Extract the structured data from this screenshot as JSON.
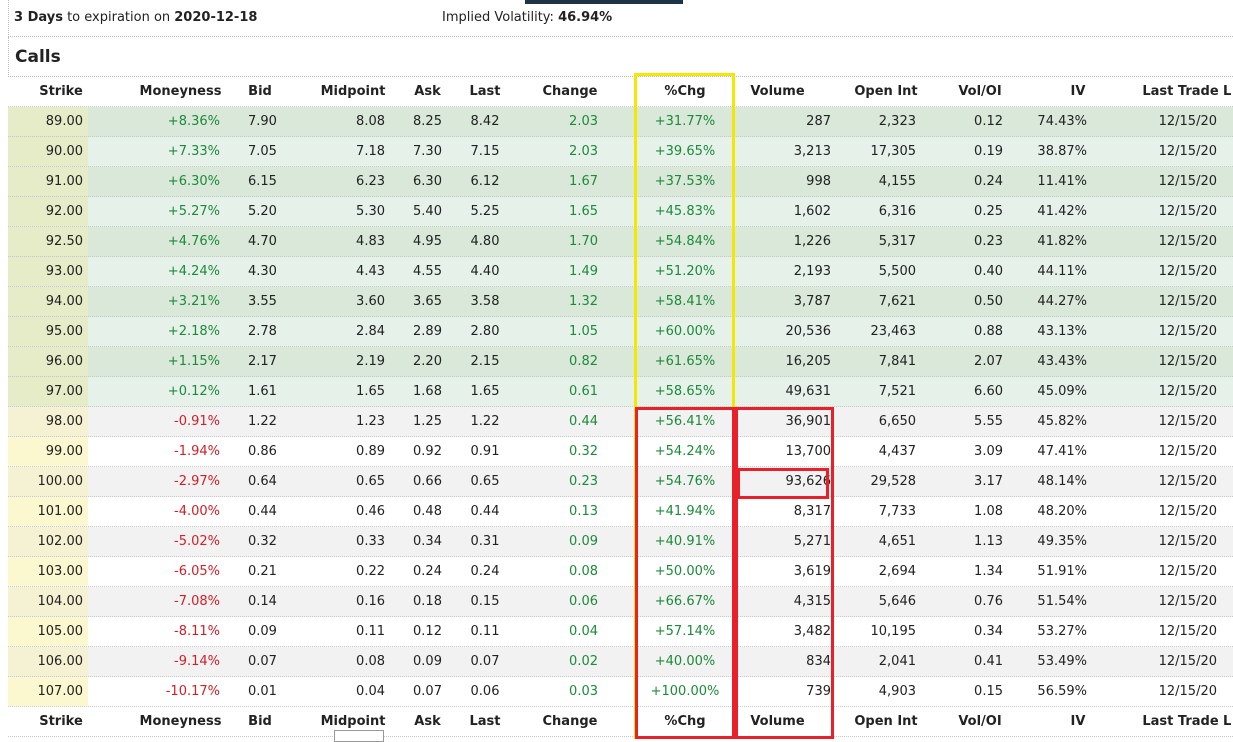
{
  "header": {
    "days": "3 Days",
    "to_expiration": " to expiration on ",
    "date": "2020-12-18",
    "iv_label": "Implied Volatility: ",
    "iv_value": "46.94%"
  },
  "section_title": "Calls",
  "columns": [
    "Strike",
    "Moneyness",
    "Bid",
    "Midpoint",
    "Ask",
    "Last",
    "Change",
    "%Chg",
    "Volume",
    "Open Int",
    "Vol/OI",
    "IV",
    "Last Trade",
    "L"
  ],
  "rows": [
    [
      "89.00",
      "+8.36%",
      "7.90",
      "8.08",
      "8.25",
      "8.42",
      "2.03",
      "+31.77%",
      "287",
      "2,323",
      "0.12",
      "74.43%",
      "12/15/20"
    ],
    [
      "90.00",
      "+7.33%",
      "7.05",
      "7.18",
      "7.30",
      "7.15",
      "2.03",
      "+39.65%",
      "3,213",
      "17,305",
      "0.19",
      "38.87%",
      "12/15/20"
    ],
    [
      "91.00",
      "+6.30%",
      "6.15",
      "6.23",
      "6.30",
      "6.12",
      "1.67",
      "+37.53%",
      "998",
      "4,155",
      "0.24",
      "11.41%",
      "12/15/20"
    ],
    [
      "92.00",
      "+5.27%",
      "5.20",
      "5.30",
      "5.40",
      "5.25",
      "1.65",
      "+45.83%",
      "1,602",
      "6,316",
      "0.25",
      "41.42%",
      "12/15/20"
    ],
    [
      "92.50",
      "+4.76%",
      "4.70",
      "4.83",
      "4.95",
      "4.80",
      "1.70",
      "+54.84%",
      "1,226",
      "5,317",
      "0.23",
      "41.82%",
      "12/15/20"
    ],
    [
      "93.00",
      "+4.24%",
      "4.30",
      "4.43",
      "4.55",
      "4.40",
      "1.49",
      "+51.20%",
      "2,193",
      "5,500",
      "0.40",
      "44.11%",
      "12/15/20"
    ],
    [
      "94.00",
      "+3.21%",
      "3.55",
      "3.60",
      "3.65",
      "3.58",
      "1.32",
      "+58.41%",
      "3,787",
      "7,621",
      "0.50",
      "44.27%",
      "12/15/20"
    ],
    [
      "95.00",
      "+2.18%",
      "2.78",
      "2.84",
      "2.89",
      "2.80",
      "1.05",
      "+60.00%",
      "20,536",
      "23,463",
      "0.88",
      "43.13%",
      "12/15/20"
    ],
    [
      "96.00",
      "+1.15%",
      "2.17",
      "2.19",
      "2.20",
      "2.15",
      "0.82",
      "+61.65%",
      "16,205",
      "7,841",
      "2.07",
      "43.43%",
      "12/15/20"
    ],
    [
      "97.00",
      "+0.12%",
      "1.61",
      "1.65",
      "1.68",
      "1.65",
      "0.61",
      "+58.65%",
      "49,631",
      "7,521",
      "6.60",
      "45.09%",
      "12/15/20"
    ],
    [
      "98.00",
      "-0.91%",
      "1.22",
      "1.23",
      "1.25",
      "1.22",
      "0.44",
      "+56.41%",
      "36,901",
      "6,650",
      "5.55",
      "45.82%",
      "12/15/20"
    ],
    [
      "99.00",
      "-1.94%",
      "0.86",
      "0.89",
      "0.92",
      "0.91",
      "0.32",
      "+54.24%",
      "13,700",
      "4,437",
      "3.09",
      "47.41%",
      "12/15/20"
    ],
    [
      "100.00",
      "-2.97%",
      "0.64",
      "0.65",
      "0.66",
      "0.65",
      "0.23",
      "+54.76%",
      "93,626",
      "29,528",
      "3.17",
      "48.14%",
      "12/15/20"
    ],
    [
      "101.00",
      "-4.00%",
      "0.44",
      "0.46",
      "0.48",
      "0.44",
      "0.13",
      "+41.94%",
      "8,317",
      "7,733",
      "1.08",
      "48.20%",
      "12/15/20"
    ],
    [
      "102.00",
      "-5.02%",
      "0.32",
      "0.33",
      "0.34",
      "0.31",
      "0.09",
      "+40.91%",
      "5,271",
      "4,651",
      "1.13",
      "49.35%",
      "12/15/20"
    ],
    [
      "103.00",
      "-6.05%",
      "0.21",
      "0.22",
      "0.24",
      "0.24",
      "0.08",
      "+50.00%",
      "3,619",
      "2,694",
      "1.34",
      "51.91%",
      "12/15/20"
    ],
    [
      "104.00",
      "-7.08%",
      "0.14",
      "0.16",
      "0.18",
      "0.15",
      "0.06",
      "+66.67%",
      "4,315",
      "5,646",
      "0.76",
      "51.54%",
      "12/15/20"
    ],
    [
      "105.00",
      "-8.11%",
      "0.09",
      "0.11",
      "0.12",
      "0.11",
      "0.04",
      "+57.14%",
      "3,482",
      "10,195",
      "0.34",
      "53.27%",
      "12/15/20"
    ],
    [
      "106.00",
      "-9.14%",
      "0.07",
      "0.08",
      "0.09",
      "0.07",
      "0.02",
      "+40.00%",
      "834",
      "2,041",
      "0.41",
      "53.49%",
      "12/15/20"
    ],
    [
      "107.00",
      "-10.17%",
      "0.01",
      "0.04",
      "0.07",
      "0.06",
      "0.03",
      "+100.00%",
      "739",
      "4,903",
      "0.15",
      "56.59%",
      "12/15/20"
    ]
  ],
  "itm_count": 10,
  "colors": {
    "positive": "#1d8a3a",
    "negative": "#d0202a",
    "highlight_yellow": "#f5e800",
    "highlight_red": "#e8202a"
  }
}
